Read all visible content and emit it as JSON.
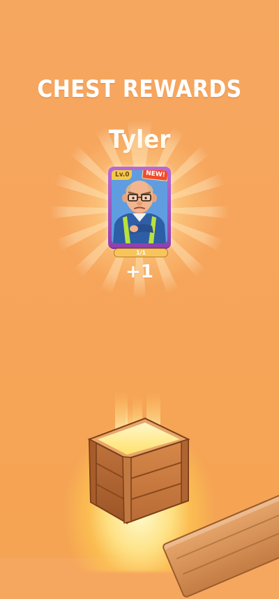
{
  "screen": {
    "title": "CHEST REWARDS"
  },
  "reward": {
    "character_name": "Tyler",
    "level_badge": "Lv.0",
    "new_badge": "NEW!",
    "progress_text": "1/1",
    "progress_fraction": 1.0,
    "amount_text": "+1"
  },
  "colors": {
    "background": "#f6a75f",
    "card_frame": "#9d4dc1",
    "progress_fill": "#f8c55b"
  },
  "icons": {
    "card_portrait": "character-portrait",
    "chest": "wooden-chest-icon",
    "plank": "wooden-plank"
  }
}
